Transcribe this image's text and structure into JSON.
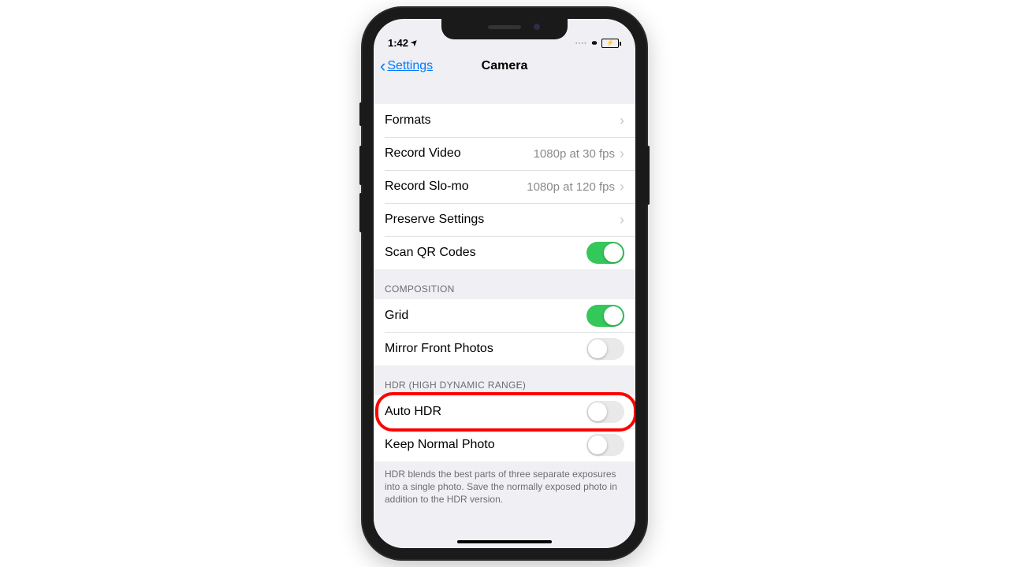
{
  "status": {
    "time": "1:42",
    "loc_glyph": "➤",
    "link_glyph": "⚭"
  },
  "nav": {
    "back_label": "Settings",
    "title": "Camera"
  },
  "rows": {
    "formats": "Formats",
    "record_video": "Record Video",
    "record_video_value": "1080p at 30 fps",
    "record_slomo": "Record Slo-mo",
    "record_slomo_value": "1080p at 120 fps",
    "preserve": "Preserve Settings",
    "scan_qr": "Scan QR Codes",
    "grid": "Grid",
    "mirror": "Mirror Front Photos",
    "auto_hdr": "Auto HDR",
    "keep_normal": "Keep Normal Photo"
  },
  "headers": {
    "composition": "COMPOSITION",
    "hdr": "HDR (HIGH DYNAMIC RANGE)"
  },
  "footer": "HDR blends the best parts of three separate exposures into a single photo. Save the normally exposed photo in addition to the HDR version.",
  "toggles": {
    "scan_qr": true,
    "grid": true,
    "mirror": false,
    "auto_hdr": false,
    "keep_normal": false
  }
}
